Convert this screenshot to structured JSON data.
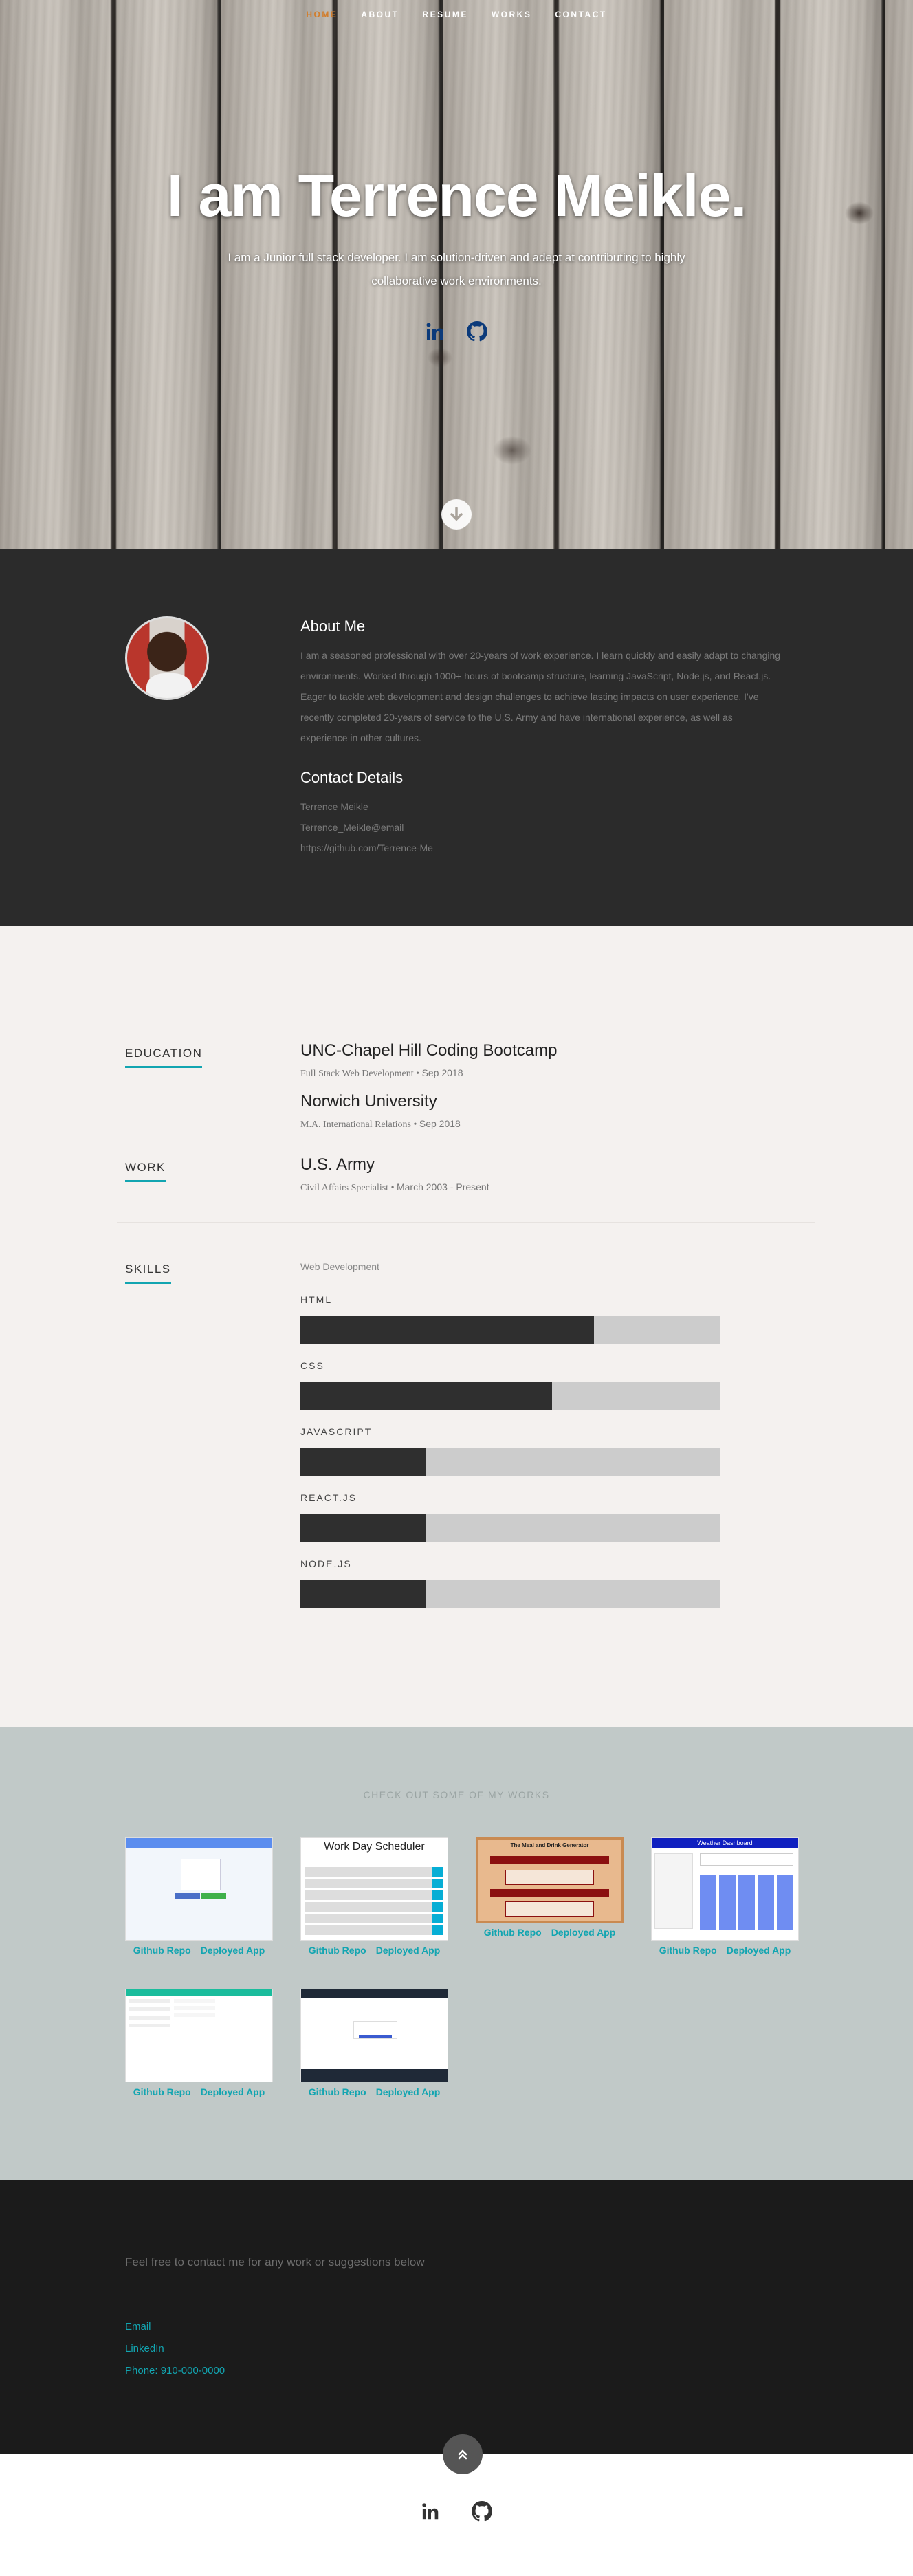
{
  "nav": [
    "HOME",
    "ABOUT",
    "RESUME",
    "WORKS",
    "CONTACT"
  ],
  "hero": {
    "title": "I am Terrence Meikle.",
    "subtitle": "I am a Junior full stack developer. I am solution-driven and adept at contributing to highly collaborative work environments.",
    "social_icons": [
      "linkedin-icon",
      "github-icon"
    ]
  },
  "about": {
    "heading": "About Me",
    "text": "I am a seasoned professional with over 20-years of work experience. I learn quickly and easily adapt to changing environments. Worked through 1000+ hours of bootcamp structure, learning JavaScript, Node.js, and React.js. Eager to tackle web development and design challenges to achieve lasting impacts on user experience. I've recently completed 20-years of service to the U.S. Army and have international experience, as well as experience in other cultures.",
    "contact_heading": "Contact Details",
    "contact": [
      "Terrence Meikle",
      "Terrence_Meikle@email",
      "https://github.com/Terrence-Me"
    ]
  },
  "resume": {
    "education": {
      "label": "EDUCATION",
      "items": [
        {
          "title": "UNC-Chapel Hill Coding Bootcamp",
          "role": "Full Stack Web Development",
          "date": "Sep 2018"
        },
        {
          "title": "Norwich University",
          "role": "M.A. International Relations",
          "date": "Sep 2018"
        }
      ]
    },
    "work": {
      "label": "WORK",
      "items": [
        {
          "title": "U.S. Army",
          "role": "Civil Affairs Specialist",
          "date": "March 2003 - Present"
        }
      ]
    },
    "skills": {
      "label": "SKILLS",
      "category": "Web Development",
      "items": [
        {
          "name": "HTML",
          "level": 0.7
        },
        {
          "name": "CSS",
          "level": 0.6
        },
        {
          "name": "JAVASCRIPT",
          "level": 0.3
        },
        {
          "name": "REACT.JS",
          "level": 0.3
        },
        {
          "name": "NODE.JS",
          "level": 0.3
        }
      ]
    }
  },
  "portfolio": {
    "title": "CHECK OUT SOME OF MY WORKS",
    "projects": [
      {
        "thumb_caption": "",
        "repo": "Github Repo",
        "app": "Deployed App"
      },
      {
        "thumb_caption": "Work Day Scheduler",
        "repo": "Github Repo",
        "app": "Deployed App"
      },
      {
        "thumb_caption": "The Meal and Drink Generator",
        "repo": "Github Repo",
        "app": "Deployed App"
      },
      {
        "thumb_caption": "Weather Dashboard",
        "repo": "Github Repo",
        "app": "Deployed App"
      },
      {
        "thumb_caption": "",
        "repo": "Github Repo",
        "app": "Deployed App"
      },
      {
        "thumb_caption": "",
        "repo": "Github Repo",
        "app": "Deployed App"
      }
    ]
  },
  "footer": {
    "text": "Feel free to contact me for any work or suggestions below",
    "links": [
      "Email",
      "LinkedIn",
      "Phone: 910-000-0000"
    ]
  },
  "colors": {
    "accent": "#12a5b1",
    "nav_active": "#d27d2b",
    "dark": "#2b2b2b",
    "footer": "#1b1b1b"
  }
}
